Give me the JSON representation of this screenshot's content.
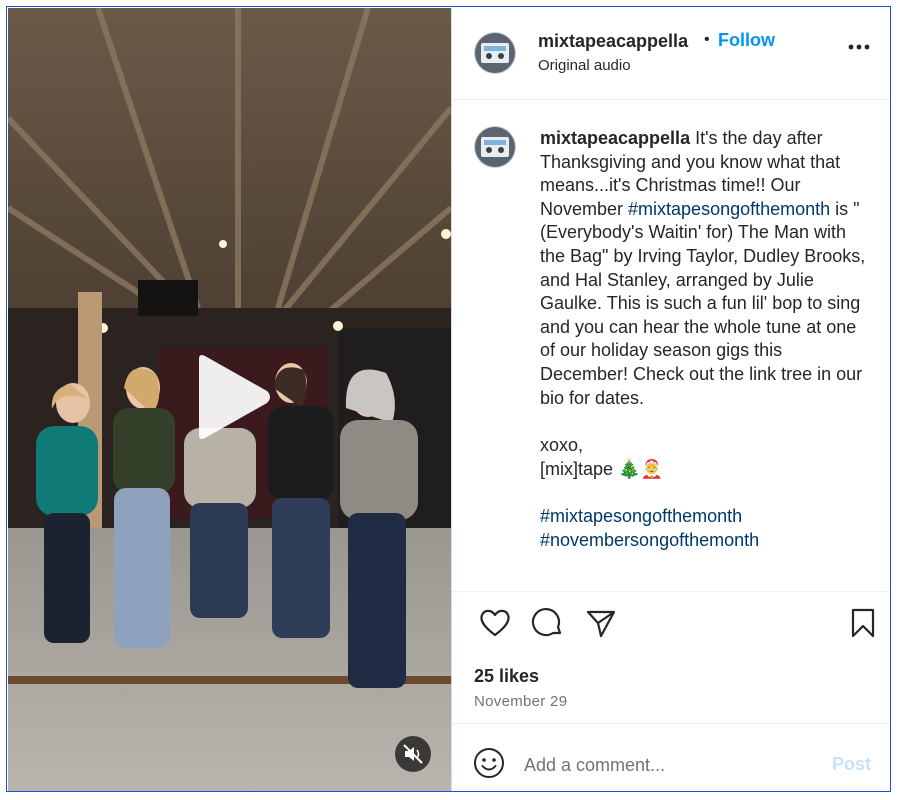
{
  "header": {
    "username": "mixtapeacappella",
    "separator": "•",
    "follow_label": "Follow",
    "subtitle": "Original audio"
  },
  "caption": {
    "username": "mixtapeacappella",
    "text_1": " It's the day after Thanksgiving and you know what that means...it's Christmas time!! Our November ",
    "hashtag_1": "#mixtapesongofthemonth",
    "text_2": " is \"(Everybody's Waitin' for) The Man with the Bag\" by Irving Taylor, Dudley Brooks, and Hal Stanley, arranged by Julie Gaulke. This is such a fun lil' bop to sing and you can hear the whole tune at one of our holiday season gigs this December! Check out the link tree in our bio for dates.",
    "signoff": "xoxo,",
    "signature": "[mix]tape 🎄🤶",
    "hashtag_2": "#mixtapesongofthemonth",
    "hashtag_3": "#novembersongofthemonth"
  },
  "actions": {
    "like_icon": "heart-icon",
    "comment_icon": "comment-icon",
    "share_icon": "share-icon",
    "save_icon": "bookmark-icon"
  },
  "stats": {
    "likes": "25 likes",
    "date": "November 29"
  },
  "comment": {
    "placeholder": "Add a comment...",
    "post_label": "Post"
  },
  "colors": {
    "follow": "#0095f6",
    "hashtag": "#00376b",
    "post_disabled": "#c7e3fb",
    "frame_border": "#1d4ed8"
  }
}
